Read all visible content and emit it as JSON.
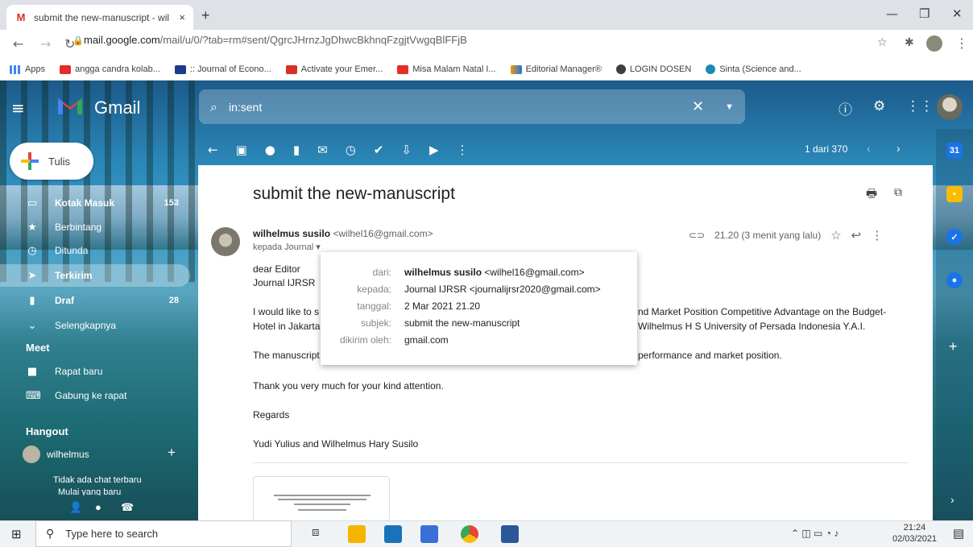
{
  "browser": {
    "tab_title": "submit the new-manuscript - wil",
    "tab_close": "×",
    "new_tab": "+",
    "url_host": "mail.google.com",
    "url_path": "/mail/u/0/?tab=rm#sent/QgrcJHrnzJgDhwcBkhnqFzgjtVwgqBlFFjB",
    "bookmarks": [
      "Apps",
      "angga candra kolab...",
      ":: Journal of Econo...",
      "Activate your Emer...",
      "Misa Malam Natal I...",
      "Editorial Manager®",
      "LOGIN DOSEN",
      "Sinta (Science and..."
    ]
  },
  "gmail": {
    "logo_text": "Gmail",
    "search_query": "in:sent",
    "compose_label": "Tulis",
    "nav": [
      {
        "label": "Kotak Masuk",
        "count": "153",
        "icon": "inbox-icon"
      },
      {
        "label": "Berbintang",
        "count": "",
        "icon": "star-icon"
      },
      {
        "label": "Ditunda",
        "count": "",
        "icon": "clock-icon"
      },
      {
        "label": "Terkirim",
        "count": "",
        "icon": "send-icon"
      },
      {
        "label": "Draf",
        "count": "28",
        "icon": "draft-icon"
      },
      {
        "label": "Selengkapnya",
        "count": "",
        "icon": "chevron-down-icon"
      }
    ],
    "meet_title": "Meet",
    "meet_items": [
      "Rapat baru",
      "Gabung ke rapat"
    ],
    "hangout_title": "Hangout",
    "hangout_user": "wilhelmus",
    "hangout_empty": "Tidak ada chat terbaru",
    "hangout_start": "Mulai yang baru",
    "pagination": "1 dari 370"
  },
  "email": {
    "subject": "submit the new-manuscript",
    "sender_name": "wilhelmus susilo",
    "sender_email": "<wilhel16@gmail.com>",
    "to_line": "kepada Journal",
    "time": "21.20 (3 menit yang lalu)",
    "body_lines": [
      "dear Editor",
      "Journal IJRSR",
      "I would like to s",
      "Hotel in Jakarta",
      "The manuscript",
      "Thank you very much for your kind attention.",
      "Regards",
      "Yudi Yulius and Wilhelmus Hary Susilo"
    ],
    "body_right": [
      "nd Market Position Competitive Advantage on the Budget-",
      "Wilhelmus H S University of Persada Indonesia Y.A.I.",
      "performance and market position."
    ]
  },
  "popup": {
    "rows": [
      {
        "key": "dari:",
        "value_bold": "wilhelmus susilo",
        "value": " <wilhel16@gmail.com>"
      },
      {
        "key": "kepada:",
        "value_bold": "",
        "value": "Journal IJRSR <journalijrsr2020@gmail.com>"
      },
      {
        "key": "tanggal:",
        "value_bold": "",
        "value": "2 Mar 2021 21.20"
      },
      {
        "key": "subjek:",
        "value_bold": "",
        "value": "submit the new-manuscript"
      },
      {
        "key": "dikirim oleh:",
        "value_bold": "",
        "value": "gmail.com"
      }
    ]
  },
  "taskbar": {
    "search_placeholder": "Type here to search",
    "time": "21:24",
    "date": "02/03/2021"
  }
}
